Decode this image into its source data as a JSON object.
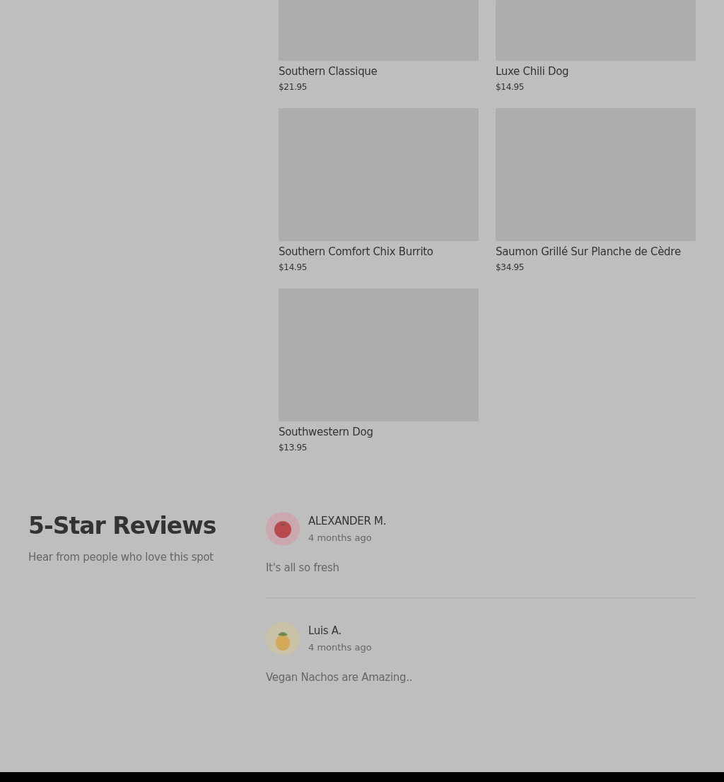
{
  "menu_items": [
    {
      "name": "Southern Classique",
      "price": "$21.95"
    },
    {
      "name": "Luxe Chili Dog",
      "price": "$14.95"
    },
    {
      "name": "Southern Comfort Chix Burrito",
      "price": "$14.95"
    },
    {
      "name": "Saumon Grillé Sur Planche de Cèdre",
      "price": "$34.95"
    },
    {
      "name": "Southwestern Dog",
      "price": "$13.95"
    }
  ],
  "reviews_section": {
    "title": "5-Star Reviews",
    "subtitle": "Hear from people who love this spot",
    "reviews": [
      {
        "kind": "tomato",
        "author": "ALEXANDER M.",
        "time": "4 months ago",
        "text": "It's all so fresh"
      },
      {
        "kind": "pineapple",
        "author": "Luis A.",
        "time": "4 months ago",
        "text": "Vegan Nachos are Amazing.."
      }
    ]
  }
}
